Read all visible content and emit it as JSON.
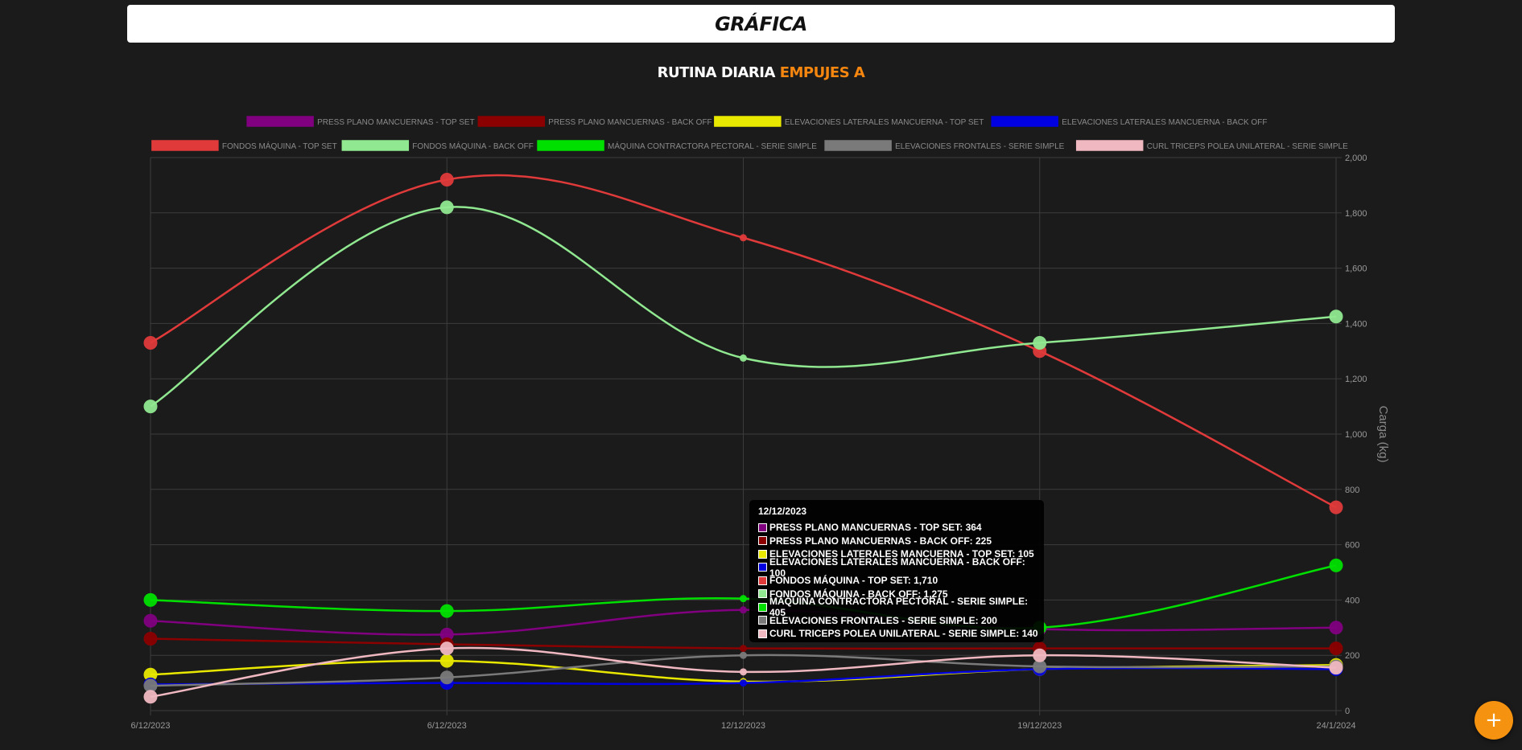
{
  "header": {
    "title": "GRÁFICA"
  },
  "routine": {
    "prefix": "RUTINA DIARIA",
    "name": "EMPUJES A"
  },
  "fab": {
    "label": "+",
    "icon": "plus-icon"
  },
  "chart_data": {
    "type": "line",
    "ylabel": "Carga (kg)",
    "y_axis_position": "right",
    "ylim": [
      0,
      2000
    ],
    "y_ticks": [
      "0",
      "200",
      "400",
      "600",
      "800",
      "1,000",
      "1,200",
      "1,400",
      "1,600",
      "1,800",
      "2,000"
    ],
    "categories": [
      "6/12/2023",
      "6/12/2023",
      "12/12/2023",
      "19/12/2023",
      "24/1/2024"
    ],
    "grid": true,
    "legend_position": "top",
    "series": [
      {
        "name": "PRESS PLANO MANCUERNAS - TOP SET",
        "color": "#800080",
        "values": [
          325,
          275,
          364,
          295,
          300
        ]
      },
      {
        "name": "PRESS PLANO MANCUERNAS - BACK OFF",
        "color": "#8b0000",
        "values": [
          260,
          240,
          225,
          225,
          225
        ]
      },
      {
        "name": "ELEVACIONES LATERALES MANCUERNA - TOP SET",
        "color": "#e8e800",
        "values": [
          130,
          180,
          105,
          150,
          165
        ]
      },
      {
        "name": "ELEVACIONES LATERALES MANCUERNA - BACK OFF",
        "color": "#0000e0",
        "values": [
          95,
          100,
          100,
          150,
          150
        ]
      },
      {
        "name": "FONDOS MÁQUINA - TOP SET",
        "color": "#e03a3a",
        "values": [
          1330,
          1920,
          1710,
          1300,
          735
        ]
      },
      {
        "name": "FONDOS MÁQUINA - BACK OFF",
        "color": "#90e890",
        "values": [
          1100,
          1820,
          1275,
          1330,
          1425
        ]
      },
      {
        "name": "MÁQUINA CONTRACTORA PECTORAL - SERIE SIMPLE",
        "color": "#00e000",
        "values": [
          400,
          360,
          405,
          300,
          525
        ]
      },
      {
        "name": "ELEVACIONES FRONTALES - SERIE SIMPLE",
        "color": "#7a7a7a",
        "values": [
          90,
          120,
          200,
          160,
          160
        ]
      },
      {
        "name": "CURL TRICEPS POLEA UNILATERAL - SERIE SIMPLE",
        "color": "#f0b8c0",
        "values": [
          50,
          225,
          140,
          200,
          155
        ]
      }
    ]
  },
  "tooltip": {
    "title": "12/12/2023",
    "rows": [
      {
        "text": "PRESS PLANO MANCUERNAS - TOP SET: 364",
        "color": "#800080"
      },
      {
        "text": "PRESS PLANO MANCUERNAS - BACK OFF: 225",
        "color": "#8b0000"
      },
      {
        "text": "ELEVACIONES LATERALES MANCUERNA - TOP SET: 105",
        "color": "#e8e800"
      },
      {
        "text": "ELEVACIONES LATERALES MANCUERNA - BACK OFF: 100",
        "color": "#0000e0"
      },
      {
        "text": "FONDOS MÁQUINA - TOP SET: 1,710",
        "color": "#e03a3a"
      },
      {
        "text": "FONDOS MÁQUINA - BACK OFF: 1,275",
        "color": "#90e890"
      },
      {
        "text": "MÁQUINA CONTRACTORA PECTORAL - SERIE SIMPLE: 405",
        "color": "#00e000"
      },
      {
        "text": "ELEVACIONES FRONTALES - SERIE SIMPLE: 200",
        "color": "#7a7a7a"
      },
      {
        "text": "CURL TRICEPS POLEA UNILATERAL - SERIE SIMPLE: 140",
        "color": "#f0b8c0"
      }
    ]
  }
}
